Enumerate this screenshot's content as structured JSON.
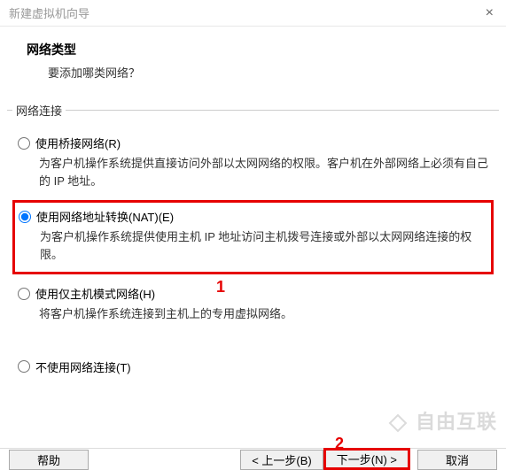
{
  "window": {
    "title": "新建虚拟机向导",
    "close_icon": "×"
  },
  "header": {
    "title": "网络类型",
    "subtitle": "要添加哪类网络？"
  },
  "group": {
    "legend": "网络连接"
  },
  "options": {
    "bridge": {
      "label": "使用桥接网络(R)",
      "desc": "为客户机操作系统提供直接访问外部以太网网络的权限。客户机在外部网络上必须有自己的 IP 地址。",
      "selected": false
    },
    "nat": {
      "label": "使用网络地址转换(NAT)(E)",
      "desc": "为客户机操作系统提供使用主机 IP 地址访问主机拨号连接或外部以太网网络连接的权限。",
      "selected": true
    },
    "hostonly": {
      "label": "使用仅主机模式网络(H)",
      "desc": "将客户机操作系统连接到主机上的专用虚拟网络。",
      "selected": false
    },
    "none": {
      "label": "不使用网络连接(T)",
      "selected": false
    }
  },
  "annotations": {
    "a1": "1",
    "a2": "2"
  },
  "buttons": {
    "help": "帮助",
    "back": "< 上一步(B)",
    "next": "下一步(N) >",
    "cancel": "取消"
  },
  "watermark": {
    "text": "自由互联"
  }
}
